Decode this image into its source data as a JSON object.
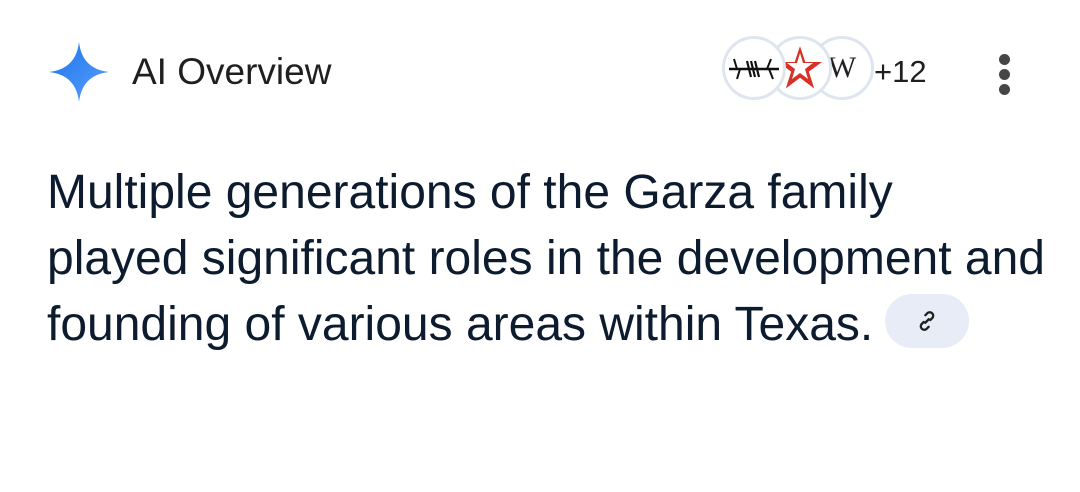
{
  "header": {
    "title": "AI Overview",
    "sources_more": "+12",
    "sources": [
      {
        "icon": "barbed-wire-logo-icon"
      },
      {
        "icon": "red-star-logo-icon"
      },
      {
        "icon": "wikipedia-logo-icon",
        "glyph": "W"
      }
    ],
    "menu_icon": "more-vert-icon"
  },
  "main": {
    "summary": "Multiple generations of the Garza family played significant roles in the development and founding of various areas within Texas.",
    "link_icon": "link-icon"
  },
  "colors": {
    "spark_blue": "#4285f4",
    "text": "#1f1f1f",
    "body_text": "#0d1b2f",
    "chip_bg": "#e7ecf6",
    "star_red": "#d93025"
  }
}
